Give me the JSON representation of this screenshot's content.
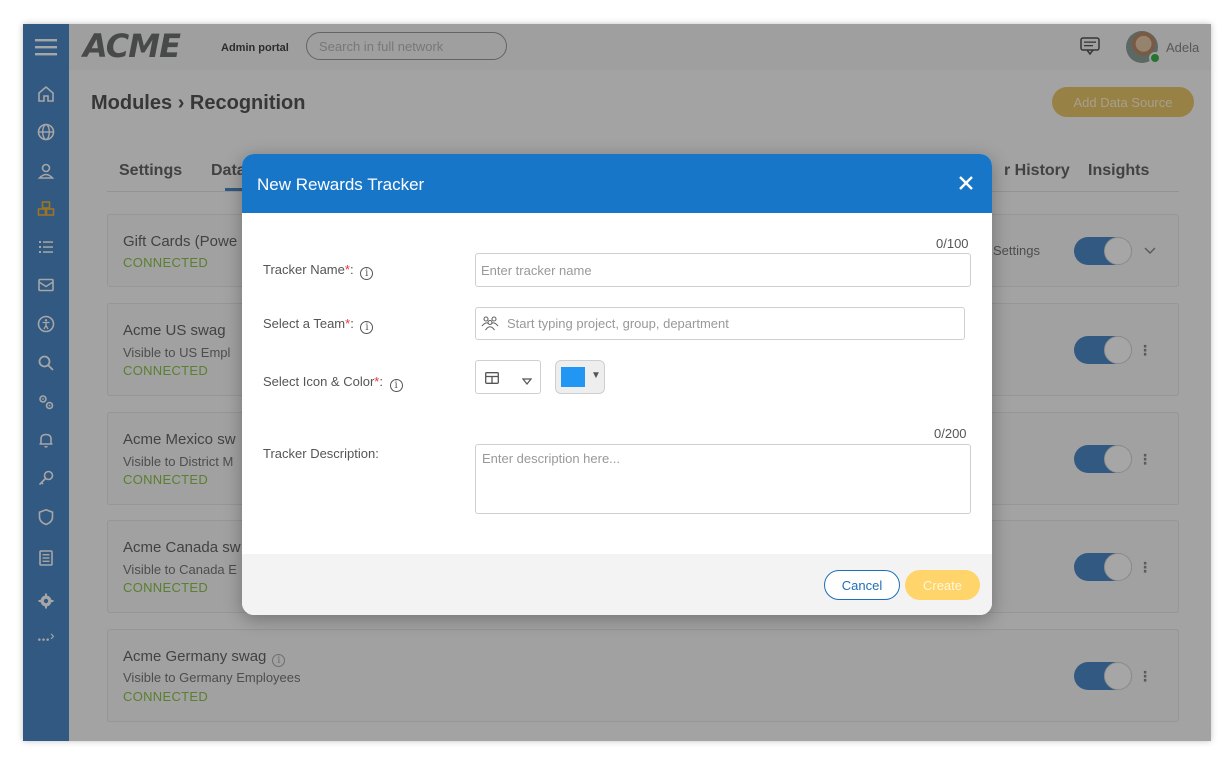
{
  "header": {
    "logo": "ACME",
    "portal_label": "Admin portal",
    "search_placeholder": "Search in full network",
    "user_name": "Adela"
  },
  "page": {
    "breadcrumb_parent": "Modules",
    "breadcrumb_sep": "›",
    "breadcrumb_current": "Recognition",
    "add_button": "Add Data Source",
    "tabs": [
      {
        "label": "Settings"
      },
      {
        "label": "Data"
      },
      {
        "label": "r History"
      },
      {
        "label": "Insights"
      }
    ],
    "cards": [
      {
        "title": "Gift Cards (Powe",
        "status": "CONNECTED",
        "right_label": "Settings"
      },
      {
        "title": "Acme US swag",
        "sub": "Visible to US Empl",
        "status": "CONNECTED"
      },
      {
        "title": "Acme Mexico sw",
        "sub": "Visible to District M",
        "status": "CONNECTED"
      },
      {
        "title": "Acme Canada sw",
        "sub": "Visible to Canada E",
        "status": "CONNECTED"
      },
      {
        "title": "Acme Germany swag",
        "sub": "Visible to Germany Employees",
        "status": "CONNECTED"
      }
    ]
  },
  "modal": {
    "title": "New Rewards Tracker",
    "tracker_name_label": "Tracker Name",
    "tracker_name_counter": "0/100",
    "tracker_name_placeholder": "Enter tracker name",
    "team_label": "Select a Team",
    "team_placeholder": "Start typing project, group, department",
    "icon_color_label": "Select Icon & Color",
    "selected_color": "#2196f3",
    "description_label": "Tracker Description:",
    "description_counter": "0/200",
    "description_placeholder": "Enter description here...",
    "cancel": "Cancel",
    "create": "Create",
    "required_mark": "*",
    "info_mark": "i",
    "colon": ":"
  },
  "icons": [
    "menu-icon",
    "home-icon",
    "globe-icon",
    "user-icon",
    "modules-icon",
    "list-icon",
    "mail-icon",
    "accessibility-icon",
    "search-icon",
    "gears-icon",
    "bell-icon",
    "key-icon",
    "shield-icon",
    "report-icon",
    "settings-icon",
    "more-icon",
    "message-icon",
    "close-icon",
    "team-icon",
    "table-icon",
    "caret-down-icon"
  ],
  "colors": {
    "accent": "#1876c9",
    "sidebar": "#4d89c6",
    "connected": "#8bc34a",
    "add_button": "#e8c66a"
  }
}
